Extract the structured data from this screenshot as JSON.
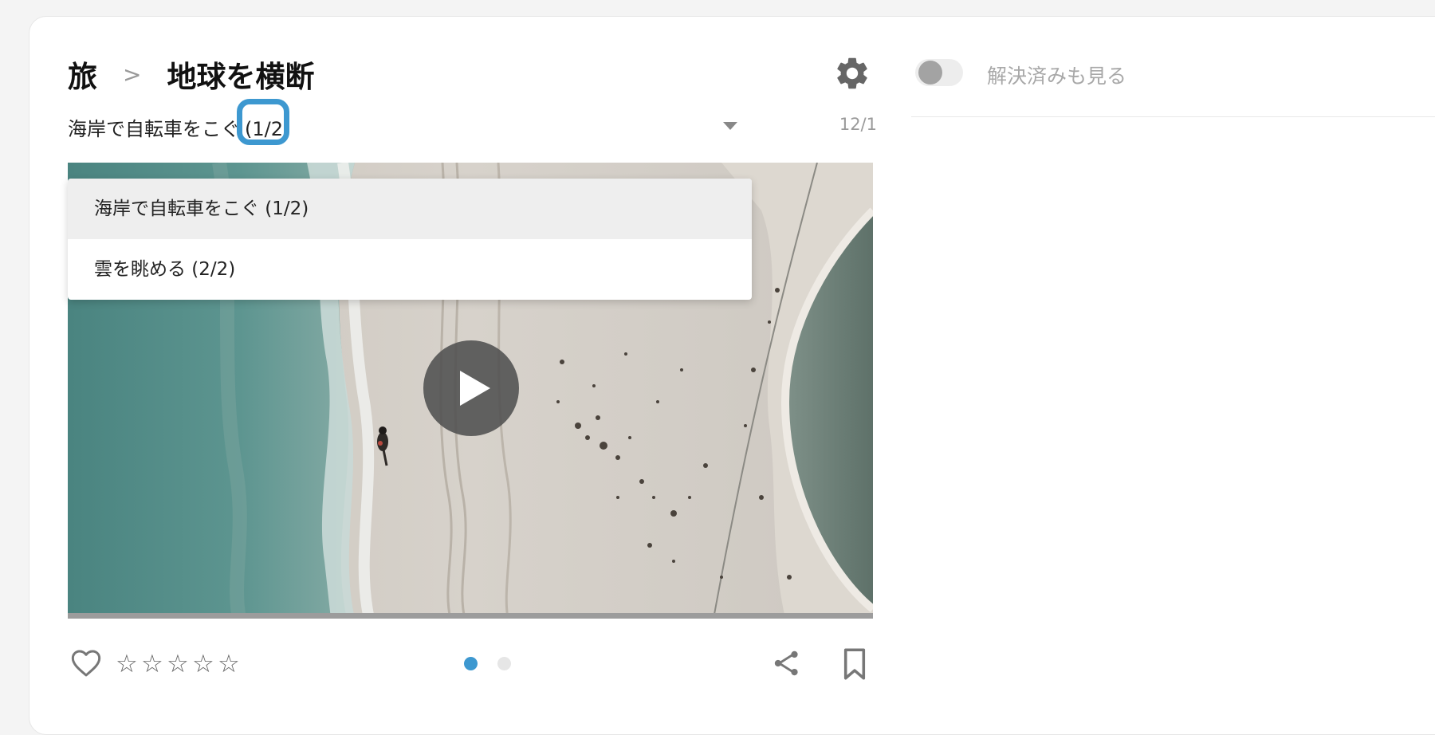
{
  "breadcrumb": {
    "parent": "旅",
    "separator": ">",
    "current": "地球を横断"
  },
  "title_row": {
    "title": "海岸で自転車をこぐ",
    "count": "(1/2)",
    "date": "12/1"
  },
  "dropdown": {
    "options": [
      {
        "label": "海岸で自転車をこぐ (1/2)",
        "selected": true
      },
      {
        "label": "雲を眺める (2/2)",
        "selected": false
      }
    ]
  },
  "video": {
    "play_icon": "play-icon"
  },
  "actions": {
    "like_icon": "heart-icon",
    "rating_stars": [
      "☆",
      "☆",
      "☆",
      "☆",
      "☆"
    ],
    "rating_value": 0,
    "pagination": {
      "current": 1,
      "total": 2
    },
    "share_icon": "share-icon",
    "bookmark_icon": "bookmark-icon"
  },
  "right_panel": {
    "toggle_label": "解決済みも見る",
    "toggle_on": false
  },
  "colors": {
    "accent": "#3d98d0",
    "text": "#222222",
    "muted": "#a8a8a8"
  }
}
